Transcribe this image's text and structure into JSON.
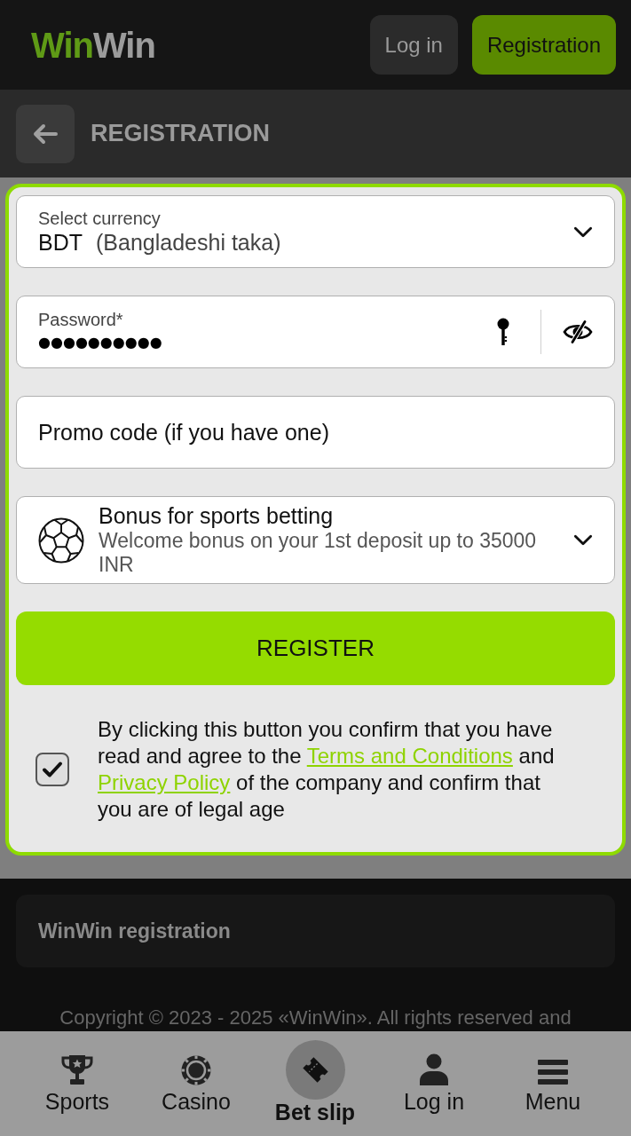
{
  "header": {
    "logo": {
      "part_1": "Win",
      "part_2": "Win"
    },
    "buttons": [
      {
        "label": "Log in",
        "kind": "secondary"
      },
      {
        "label": "Registration",
        "kind": "primary"
      }
    ]
  },
  "page_title": {
    "title": "REGISTRATION"
  },
  "form": {
    "currency": {
      "label": "Select currency",
      "code": "BDT",
      "name": "(Bangladeshi taka)"
    },
    "password": {
      "label": "Password*",
      "value": "●●●●●●●●●●"
    },
    "promo_code": {
      "placeholder": "Promo code (if you have one)"
    },
    "bonus": {
      "title": "Bonus for sports betting",
      "description": "Welcome bonus on your 1st deposit up to 35000 INR"
    },
    "submit": {
      "label": "REGISTER"
    },
    "consent": {
      "checked": true,
      "parts": [
        {
          "kind": "text",
          "text": "By clicking this button you confirm that you have read and agree to the"
        },
        {
          "kind": "link",
          "text": "Terms and Conditions"
        },
        {
          "kind": "text",
          "text": "and"
        },
        {
          "kind": "link",
          "text": "Privacy Policy"
        },
        {
          "kind": "text",
          "text": "of the company and confirm that you are of legal age"
        }
      ]
    }
  },
  "footer": {
    "section_title": "WinWin registration",
    "copyright": "Copyright © 2023 - 2025 «WinWin». All rights reserved and"
  },
  "bottom_nav": [
    {
      "label": "Sports",
      "kind": "tab"
    },
    {
      "label": "Casino",
      "kind": "tab"
    },
    {
      "label": "Bet slip",
      "kind": "center"
    },
    {
      "label": "Log in",
      "kind": "tab"
    },
    {
      "label": "Menu",
      "kind": "tab"
    }
  ]
}
